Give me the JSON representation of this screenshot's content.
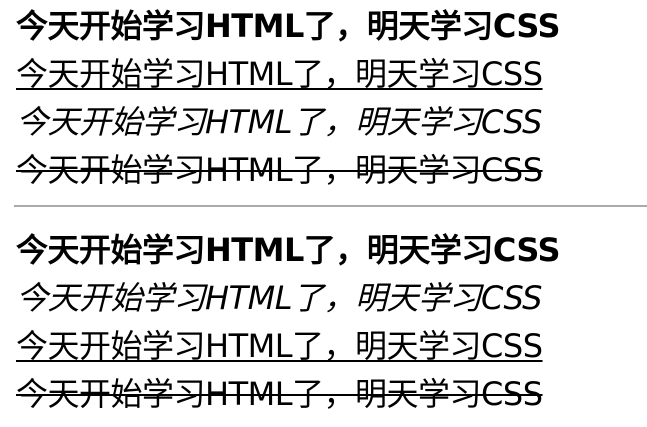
{
  "top_group": {
    "lines": [
      {
        "text": "今天开始学习HTML了，明天学习CSS",
        "style": "bold"
      },
      {
        "text": "今天开始学习HTML了，明天学习CSS",
        "style": "underline"
      },
      {
        "text": "今天开始学习HTML了，明天学习CSS",
        "style": "italic"
      },
      {
        "text": "今天开始学习HTML了，明天学习CSS",
        "style": "strikethrough"
      }
    ]
  },
  "bottom_group": {
    "lines": [
      {
        "text": "今天开始学习HTML了，明天学习CSS",
        "style": "bold"
      },
      {
        "text": "今天开始学习HTML了，明天学习CSS",
        "style": "italic"
      },
      {
        "text": "今天开始学习HTML了，明天学习CSS",
        "style": "underline"
      },
      {
        "text": "今天开始学习HTML了，明天学习CSS",
        "style": "strikethrough"
      }
    ]
  },
  "colors": {
    "text": "#000000",
    "divider": "#aaaaaa",
    "background": "#ffffff"
  }
}
